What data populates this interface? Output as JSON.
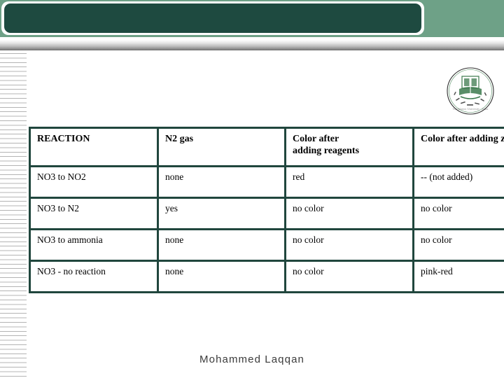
{
  "slide": {
    "banner": {
      "title": "",
      "band_color": "#6ea187",
      "plate_color": "#1e4a40"
    },
    "logo": {
      "name": "islamic-university-gaza-logo",
      "arabic_text": "الجامعة الإسلامية غزة",
      "english_text": "The Islamic University - Gaza",
      "color": "#3c7a4e"
    },
    "footer": {
      "author": "Mohammed  Laqqan"
    }
  },
  "table": {
    "border_color": "#20463d",
    "headers": [
      "REACTION",
      "N2 gas",
      "Color after adding reagents",
      "Color after adding zinc"
    ],
    "headers_line1": [
      "REACTION",
      "N2 gas",
      "Color after",
      "Color after adding zinc"
    ],
    "headers_line2": [
      "",
      "",
      "adding reagents",
      ""
    ],
    "rows": [
      {
        "reaction": "NO3 to NO2",
        "n2_gas": "none",
        "color_after_reagents": "red",
        "color_after_zinc": "-- (not added)"
      },
      {
        "reaction": "NO3 to N2",
        "n2_gas": "yes",
        "color_after_reagents": "no color",
        "color_after_zinc": "no color"
      },
      {
        "reaction": "NO3 to ammonia",
        "n2_gas": "none",
        "color_after_reagents": "no color",
        "color_after_zinc": "no color"
      },
      {
        "reaction": "NO3 - no reaction",
        "n2_gas": "none",
        "color_after_reagents": "no color",
        "color_after_zinc": "pink-red"
      }
    ]
  }
}
